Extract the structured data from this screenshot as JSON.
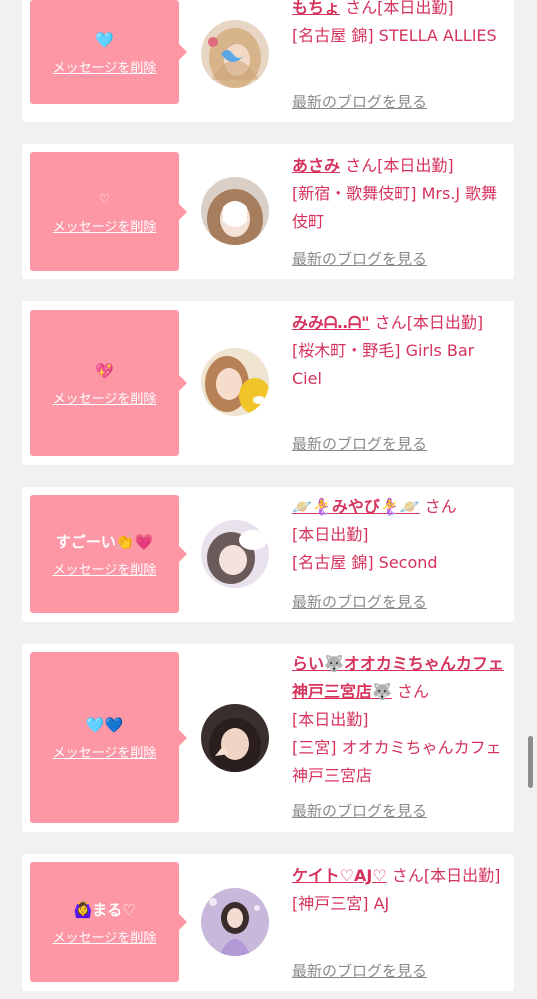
{
  "common": {
    "delete_label": "メッセージを削除",
    "blog_label": "最新のブログを見る",
    "san_label": "さん"
  },
  "cards": [
    {
      "message": "🩵",
      "name": "もちょ",
      "status": "[本日出勤]",
      "shop": "[名古屋 錦] STELLA ALLIES"
    },
    {
      "message": "♡",
      "name": "あさみ",
      "status": "[本日出勤]",
      "shop": "[新宿・歌舞伎町] Mrs.J 歌舞伎町"
    },
    {
      "message": "💖",
      "name": "みみᗩ‥ᗩ\"",
      "status": "[本日出勤]",
      "shop": "[桜木町・野毛] Girls Bar Ciel"
    },
    {
      "message": "すごーい👏💗",
      "name": "🪐🧜‍♀️みやび🧜‍♀️🪐",
      "status": "[本日出勤]",
      "shop": "[名古屋 錦] Second"
    },
    {
      "message": "🩵💙",
      "name": "らい🐺オオカミちゃんカフェ神戸三宮店🐺",
      "status": "[本日出勤]",
      "shop": "[三宮] オオカミちゃんカフェ神戸三宮店"
    },
    {
      "message": "🙆‍♀️まる♡",
      "name": "ケイト♡AJ♡",
      "status": "[本日出勤]",
      "shop": "[神戸三宮] AJ"
    }
  ]
}
